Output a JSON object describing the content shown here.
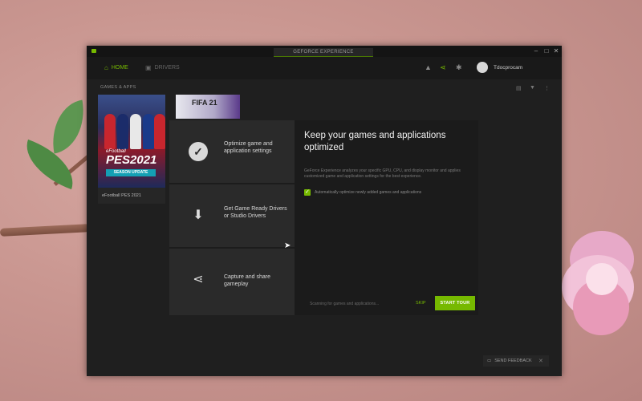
{
  "app": {
    "brand": "GEFORCE EXPERIENCE",
    "accent_color": "#76b900"
  },
  "nav": {
    "home_label": "HOME",
    "drivers_label": "DRIVERS",
    "username": "Tdocprocam"
  },
  "toolbar_icons": [
    "notification-icon",
    "share-icon",
    "gear-icon"
  ],
  "window_controls": [
    "minimize-icon",
    "maximize-icon",
    "close-icon"
  ],
  "library": {
    "section_label": "GAMES & APPS",
    "games": [
      {
        "title": "eFootball PES 2021",
        "art_subtitle": "eFootball",
        "art_title": "PES2021",
        "art_banner": "SEASON UPDATE"
      },
      {
        "art_title": "FIFA 21"
      }
    ]
  },
  "onboarding": {
    "features": [
      {
        "icon": "check-circle-icon",
        "label": "Optimize game and application settings"
      },
      {
        "icon": "download-icon",
        "label": "Get Game Ready Drivers or Studio Drivers"
      },
      {
        "icon": "share-icon",
        "label": "Capture and share gameplay"
      }
    ],
    "title": "Keep your games and applications optimized",
    "description": "GeForce Experience analyzes your specific GPU, CPU, and display monitor and applies customized game and application settings for the best experience.",
    "checkbox_label": "Automatically optimize newly added games and applications",
    "checkbox_checked": true,
    "scanning_text": "Scanning for games and applications...",
    "skip_label": "SKIP",
    "start_label": "START TOUR"
  },
  "feedback": {
    "label": "SEND FEEDBACK"
  }
}
